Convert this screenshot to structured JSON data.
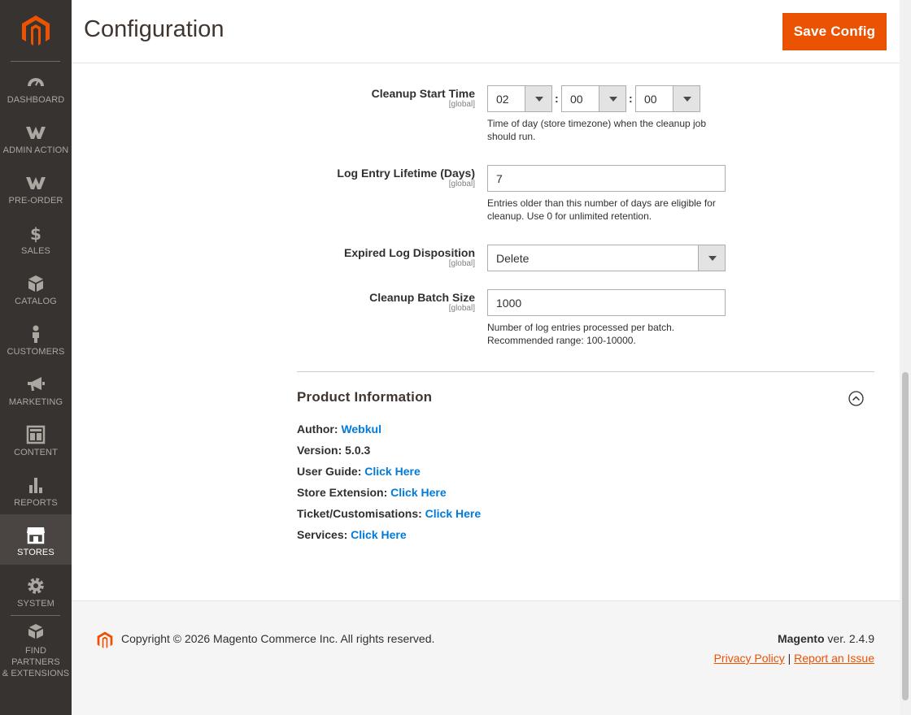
{
  "sidebar": {
    "items": [
      {
        "key": "dashboard",
        "label": "DASHBOARD"
      },
      {
        "key": "admin-action",
        "label": "ADMIN ACTION"
      },
      {
        "key": "pre-order",
        "label": "PRE-ORDER"
      },
      {
        "key": "sales",
        "label": "SALES"
      },
      {
        "key": "catalog",
        "label": "CATALOG"
      },
      {
        "key": "customers",
        "label": "CUSTOMERS"
      },
      {
        "key": "marketing",
        "label": "MARKETING"
      },
      {
        "key": "content",
        "label": "CONTENT"
      },
      {
        "key": "reports",
        "label": "REPORTS"
      },
      {
        "key": "stores",
        "label": "STORES",
        "active": true
      },
      {
        "key": "system",
        "label": "SYSTEM"
      },
      {
        "key": "find-partners",
        "label_line1": "FIND PARTNERS",
        "label_line2": "& EXTENSIONS"
      }
    ]
  },
  "header": {
    "title": "Configuration",
    "save_label": "Save Config"
  },
  "fields": {
    "cleanup_start_time": {
      "label": "Cleanup Start Time",
      "scope": "[global]",
      "hour": "02",
      "minute": "00",
      "second": "00",
      "separator": ":",
      "note": "Time of day (store timezone) when the cleanup job should run."
    },
    "log_lifetime": {
      "label": "Log Entry Lifetime (Days)",
      "scope": "[global]",
      "value": "7",
      "note": "Entries older than this number of days are eligible for cleanup. Use 0 for unlimited retention."
    },
    "expired_disposition": {
      "label": "Expired Log Disposition",
      "scope": "[global]",
      "value": "Delete"
    },
    "batch_size": {
      "label": "Cleanup Batch Size",
      "scope": "[global]",
      "value": "1000",
      "note": "Number of log entries processed per batch. Recommended range: 100-10000."
    }
  },
  "product_info": {
    "title": "Product Information",
    "author_label": "Author:",
    "author_value": "Webkul",
    "version_label": "Version:",
    "version_value": "5.0.3",
    "user_guide_label": "User Guide:",
    "store_extension_label": "Store Extension:",
    "ticket_label": "Ticket/Customisations:",
    "services_label": "Services:",
    "link_text": "Click Here"
  },
  "footer": {
    "copyright": "Copyright © 2026 Magento Commerce Inc. All rights reserved.",
    "brand": "Magento",
    "version_text": " ver. 2.4.9",
    "privacy": "Privacy Policy",
    "divider": "|",
    "report": "Report an Issue"
  },
  "colors": {
    "sidebar_bg": "#373330",
    "accent": "#eb5202",
    "link": "#007bdb"
  }
}
